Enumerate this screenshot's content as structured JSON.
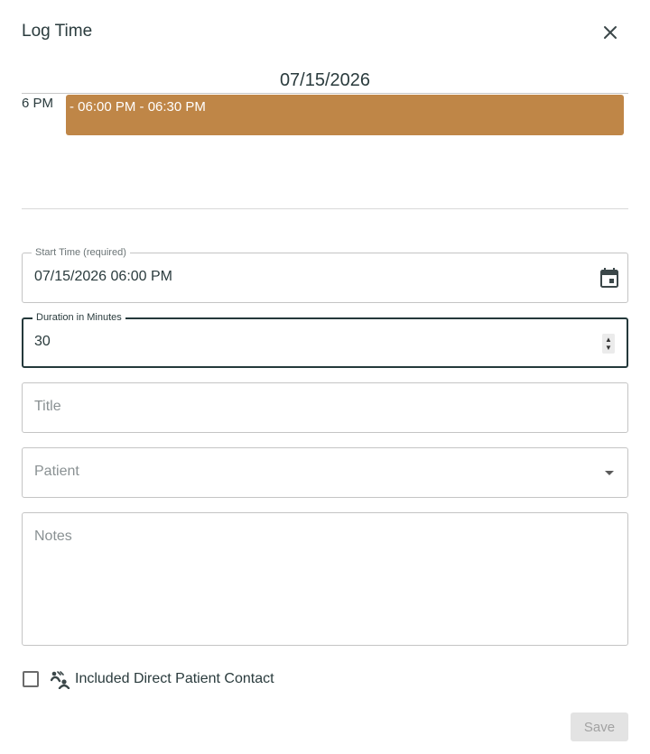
{
  "dialog": {
    "title": "Log Time",
    "close_icon": "close-icon"
  },
  "calendar": {
    "date": "07/15/2026",
    "hour_label": "6 PM",
    "event_label": "- 06:00 PM - 06:30 PM",
    "event_color": "#bf8647"
  },
  "form": {
    "start_time": {
      "label": "Start Time (required)",
      "value": "07/15/2026 06:00 PM",
      "icon": "calendar-icon"
    },
    "duration": {
      "label": "Duration in Minutes",
      "value": "30"
    },
    "title": {
      "placeholder": "Title"
    },
    "patient": {
      "placeholder": "Patient",
      "icon": "dropdown-arrow-icon"
    },
    "notes": {
      "placeholder": "Notes"
    },
    "direct_contact": {
      "label": "Included Direct Patient Contact",
      "checked": false,
      "icon": "patient-contact-icon"
    }
  },
  "actions": {
    "save_label": "Save",
    "save_disabled": true
  },
  "colors": {
    "text": "#2a3b3d",
    "accent": "#bf8647",
    "focused_border": "#24393b",
    "disabled_button_bg": "#e3e3e3"
  }
}
